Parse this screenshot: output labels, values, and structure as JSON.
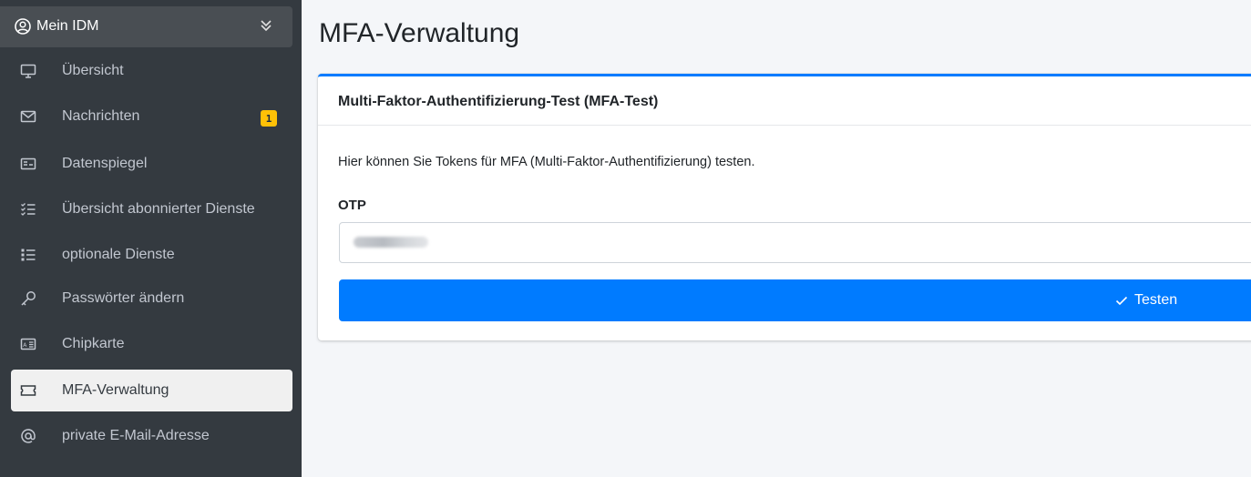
{
  "sidebar": {
    "header": {
      "label": "Mein IDM",
      "icon": "user-circle-icon",
      "chevron": "chevrons-down-icon"
    },
    "items": [
      {
        "label": "Übersicht",
        "icon": "monitor-icon"
      },
      {
        "label": "Nachrichten",
        "icon": "envelope-icon",
        "badge": "1"
      },
      {
        "label": "Datenspiegel",
        "icon": "id-card-icon"
      },
      {
        "label": "Übersicht abonnierter Dienste",
        "icon": "checklist-icon"
      },
      {
        "label": "optionale Dienste",
        "icon": "list-icon"
      },
      {
        "label": "Passwörter ändern",
        "icon": "key-icon"
      },
      {
        "label": "Chipkarte",
        "icon": "chip-card-icon"
      },
      {
        "label": "MFA-Verwaltung",
        "icon": "ticket-icon",
        "active": true
      },
      {
        "label": "private E-Mail-Adresse",
        "icon": "at-sign-icon"
      }
    ]
  },
  "main": {
    "title": "MFA-Verwaltung",
    "card": {
      "title": "Multi-Faktor-Authentifizierung-Test (MFA-Test)",
      "description": "Hier können Sie Tokens für MFA (Multi-Faktor-Authentifizierung) testen.",
      "field_label": "OTP",
      "button_label": "Testen",
      "button_icon": "check-icon"
    }
  },
  "colors": {
    "sidebar_bg": "#343a40",
    "primary": "#007bff",
    "badge": "#ffc107",
    "active_item_bg": "#f0f0f0"
  }
}
